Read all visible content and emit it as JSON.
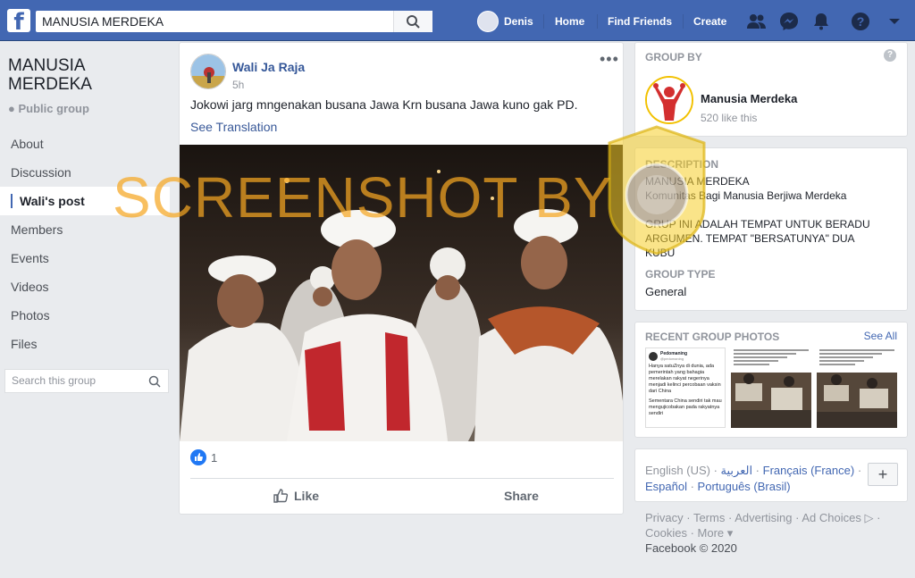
{
  "topbar": {
    "search_value": "MANUSIA MERDEKA",
    "user_name": "Denis",
    "home": "Home",
    "find_friends": "Find Friends",
    "create": "Create"
  },
  "left": {
    "group_title": "MANUSIA MERDEKA",
    "privacy": "Public group",
    "nav": [
      "About",
      "Discussion",
      "Wali's post",
      "Members",
      "Events",
      "Videos",
      "Photos",
      "Files"
    ],
    "search_placeholder": "Search this group"
  },
  "post": {
    "author": "Wali Ja Raja",
    "time": "5h",
    "text": "Jokowi jarg mngenakan busana Jawa Krn busana Jawa kuno gak PD.",
    "see_translation": "See Translation",
    "watermark": "SCREENSHOT BY",
    "like_count": "1",
    "like_label": "Like",
    "share_label": "Share"
  },
  "right": {
    "group_by_title": "GROUP BY",
    "page_name": "Manusia Merdeka",
    "page_likes": "520 like this",
    "description_title": "DESCRIPTION",
    "description_lines": [
      "MANUSIA MERDEKA",
      "Komunitas Bagi Manusia Berjiwa Merdeka",
      "",
      "GRUP INI ADALAH TEMPAT UNTUK BERADU",
      "ARGUMEN. TEMPAT \"BERSATUNYA\" DUA",
      "KUBU"
    ],
    "group_type_title": "GROUP TYPE",
    "group_type": "General",
    "recent_photos_title": "RECENT GROUP PHOTOS",
    "see_all": "See All",
    "thumb1_name": "Pedomaning",
    "thumb1_handle": "@pedomaning",
    "thumb1_text1": "Hanya satuZnya di dunia, ada pemerintah yang bahagia merelakan rakyat negerinya menjadi kelinci percobaan vaksin dari China",
    "thumb1_text2": "Sementara China sendiri tak mau mengujicobakan pada rakyatnya sendiri",
    "languages": {
      "en": "English (US)",
      "ar": "العربية",
      "fr": "Français (France)",
      "es": "Español",
      "pt": "Português (Brasil)"
    },
    "footer_links": [
      "Privacy",
      "Terms",
      "Advertising",
      "Ad Choices",
      "Cookies",
      "More"
    ],
    "copyright": "Facebook © 2020"
  },
  "colors": {
    "brand": "#4267b2",
    "link": "#385898",
    "watermark": "#f5a623"
  }
}
